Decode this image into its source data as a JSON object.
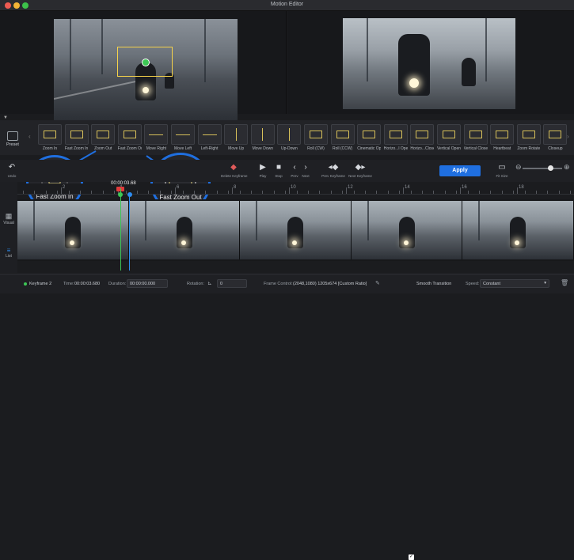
{
  "window": {
    "title": "Motion Editor"
  },
  "preset": {
    "label": "Preset",
    "items": [
      "Zoom In",
      "Fast Zoom In",
      "Zoom Out",
      "Fast Zoom Out",
      "Move Right",
      "Move Left",
      "Left-Right",
      "Move Up",
      "Move Down",
      "Up-Down",
      "Roll (CW)",
      "Roll (CCW)",
      "Cinematic Open",
      "Horizo...l Open",
      "Horizo...Close",
      "Vertical Open",
      "Vertical Close",
      "Heartbeat",
      "Zoom Rotate",
      "Closeup"
    ]
  },
  "toolbar": {
    "undo": "Undo",
    "delete_keyframe": "Delete Keyframe",
    "play": "Play",
    "stop": "Stop",
    "prev": "Prev",
    "next": "Next",
    "prev_keyframe": "Prev Keyframe",
    "next_keyframe": "Next Keyframe",
    "apply": "Apply",
    "fit_size": "Fit Size"
  },
  "callouts": {
    "left": "Fast Zoom In",
    "right": "Fast Zoom Out"
  },
  "timeline": {
    "playhead_time": "00:00:03.68",
    "ruler_labels": [
      "2",
      "4",
      "6",
      "8",
      "10",
      "12",
      "14",
      "16",
      "18"
    ],
    "tracks": {
      "visual": "Visual",
      "list": "List"
    }
  },
  "status": {
    "keyframe": "Keyframe 2",
    "time_label": "Time:",
    "time_value": "00:00:03.680",
    "duration_label": "Duration:",
    "duration_value": "00:00:00.000",
    "rotation_label": "Rotation:",
    "rotation_value": "0",
    "frame_control_label": "Frame Control:",
    "frame_control_value": "(2048,1080)  1205x674  [Custom Ratio]",
    "smooth_transition": "Smooth Transition",
    "speed_label": "Speed:",
    "speed_value": "Constant"
  },
  "colors": {
    "accent": "#1f6fe0",
    "keyframe": "#3dc755",
    "playhead": "#e03c3c"
  }
}
